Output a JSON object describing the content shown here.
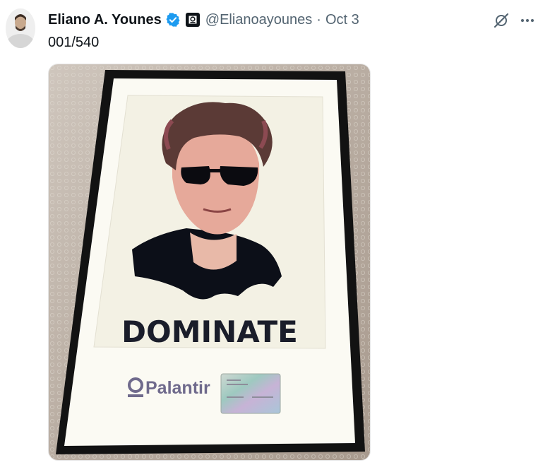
{
  "author": {
    "display_name": "Eliano A. Younes",
    "handle": "@Elianoayounes",
    "verified": true,
    "avatar_icon": "profile-photo"
  },
  "tweet": {
    "separator": "·",
    "date": "Oct 3",
    "text": "001/540"
  },
  "media": {
    "poster_text": "DOMINATE",
    "logo_text": "Palantir"
  },
  "icons": {
    "grok": "grok-icon",
    "more": "more-icon",
    "verified": "verified-badge-icon",
    "affiliate": "affiliate-badge-icon"
  },
  "colors": {
    "text_primary": "#0f1419",
    "text_secondary": "#536471",
    "verified_blue": "#1d9bf0"
  }
}
